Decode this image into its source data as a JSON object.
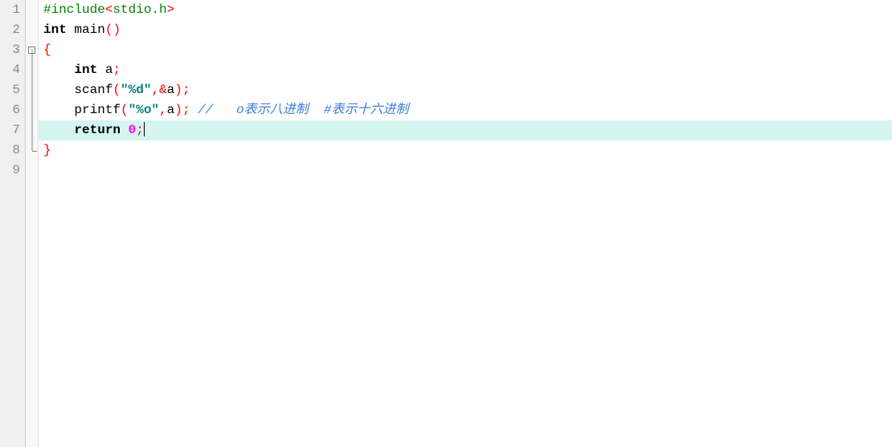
{
  "gutter": {
    "lines": [
      "1",
      "2",
      "3",
      "4",
      "5",
      "6",
      "7",
      "8",
      "9"
    ]
  },
  "fold": {
    "collapse_symbol": "−"
  },
  "code": {
    "line1": {
      "preproc": "#include",
      "lt": "<",
      "hdr": "stdio.h",
      "gt": ">"
    },
    "line2": {
      "kw_int": "int",
      "sp": " ",
      "main": "main",
      "lp": "(",
      "rp": ")"
    },
    "line3": {
      "brace": "{"
    },
    "line4": {
      "indent": "    ",
      "kw_int": "int",
      "sp": " ",
      "var": "a",
      "semi": ";"
    },
    "line5": {
      "indent": "    ",
      "fn": "scanf",
      "lp": "(",
      "str": "\"%d\"",
      "comma": ",",
      "amp": "&",
      "var": "a",
      "rp": ")",
      "semi": ";"
    },
    "line6": {
      "indent": "    ",
      "fn": "printf",
      "lp": "(",
      "str": "\"%o\"",
      "comma": ",",
      "var": "a",
      "rp": ")",
      "semi": ";",
      "sp": " ",
      "comment": "//   o表示八进制  #表示十六进制"
    },
    "line7": {
      "indent": "    ",
      "kw_return": "return",
      "sp": " ",
      "num": "0",
      "semi": ";"
    },
    "line8": {
      "brace": "}"
    }
  },
  "highlighted_line": 7
}
